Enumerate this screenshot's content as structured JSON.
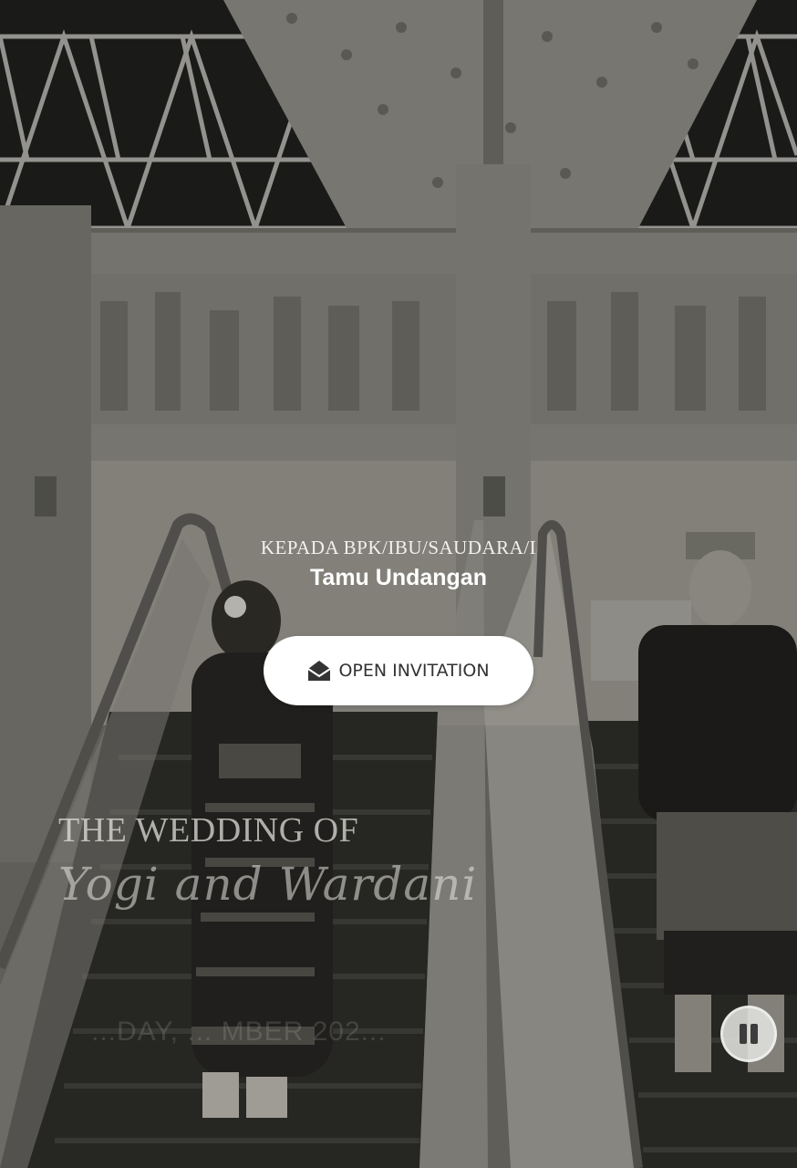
{
  "cover": {
    "to_label": "KEPADA BPK/IBU/SAUDARA/I",
    "guest_name": "Tamu Undangan",
    "open_button_label": "OPEN INVITATION",
    "open_button_icon": "envelope-open-icon",
    "wedding_of": "THE WEDDING OF",
    "couple_names": "Yogi and Wardani",
    "date_text": "...DAY, ... MBER 202..."
  },
  "music_control": {
    "icon": "pause-icon"
  },
  "colors": {
    "button_bg": "#ffffff",
    "button_text": "#333333",
    "text_light": "#f2f1ee"
  }
}
